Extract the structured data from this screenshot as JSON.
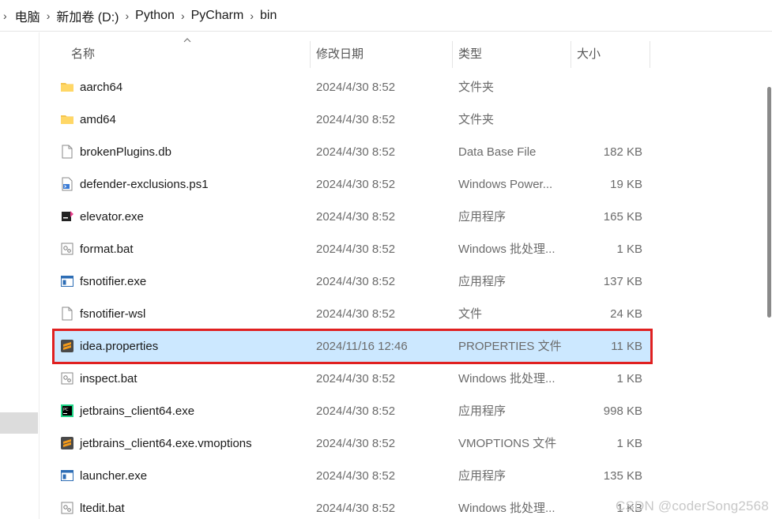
{
  "breadcrumb": [
    "电脑",
    "新加卷 (D:)",
    "Python",
    "PyCharm",
    "bin"
  ],
  "columns": {
    "name": "名称",
    "date": "修改日期",
    "type": "类型",
    "size": "大小"
  },
  "files": [
    {
      "name": "aarch64",
      "date": "2024/4/30 8:52",
      "type": "文件夹",
      "size": "",
      "icon": "folder-icon"
    },
    {
      "name": "amd64",
      "date": "2024/4/30 8:52",
      "type": "文件夹",
      "size": "",
      "icon": "folder-icon"
    },
    {
      "name": "brokenPlugins.db",
      "date": "2024/4/30 8:52",
      "type": "Data Base File",
      "size": "182 KB",
      "icon": "file-icon"
    },
    {
      "name": "defender-exclusions.ps1",
      "date": "2024/4/30 8:52",
      "type": "Windows Power...",
      "size": "19 KB",
      "icon": "powershell-script-icon"
    },
    {
      "name": "elevator.exe",
      "date": "2024/4/30 8:52",
      "type": "应用程序",
      "size": "165 KB",
      "icon": "elevator-app-icon"
    },
    {
      "name": "format.bat",
      "date": "2024/4/30 8:52",
      "type": "Windows 批处理...",
      "size": "1 KB",
      "icon": "batch-file-icon"
    },
    {
      "name": "fsnotifier.exe",
      "date": "2024/4/30 8:52",
      "type": "应用程序",
      "size": "137 KB",
      "icon": "application-window-icon"
    },
    {
      "name": "fsnotifier-wsl",
      "date": "2024/4/30 8:52",
      "type": "文件",
      "size": "24 KB",
      "icon": "file-icon"
    },
    {
      "name": "idea.properties",
      "date": "2024/11/16 12:46",
      "type": "PROPERTIES 文件",
      "size": "11 KB",
      "icon": "sublime-text-icon",
      "selected": true
    },
    {
      "name": "inspect.bat",
      "date": "2024/4/30 8:52",
      "type": "Windows 批处理...",
      "size": "1 KB",
      "icon": "batch-file-icon"
    },
    {
      "name": "jetbrains_client64.exe",
      "date": "2024/4/30 8:52",
      "type": "应用程序",
      "size": "998 KB",
      "icon": "pycharm-icon"
    },
    {
      "name": "jetbrains_client64.exe.vmoptions",
      "date": "2024/4/30 8:52",
      "type": "VMOPTIONS 文件",
      "size": "1 KB",
      "icon": "sublime-text-icon"
    },
    {
      "name": "launcher.exe",
      "date": "2024/4/30 8:52",
      "type": "应用程序",
      "size": "135 KB",
      "icon": "application-window-icon"
    },
    {
      "name": "ltedit.bat",
      "date": "2024/4/30 8:52",
      "type": "Windows 批处理...",
      "size": "1 KB",
      "icon": "batch-file-icon"
    }
  ],
  "watermark": "CSDN @coderSong2568",
  "colors": {
    "selection_bg": "#cce8ff",
    "highlight_border": "#e02020",
    "folder": "#f4c44e"
  }
}
